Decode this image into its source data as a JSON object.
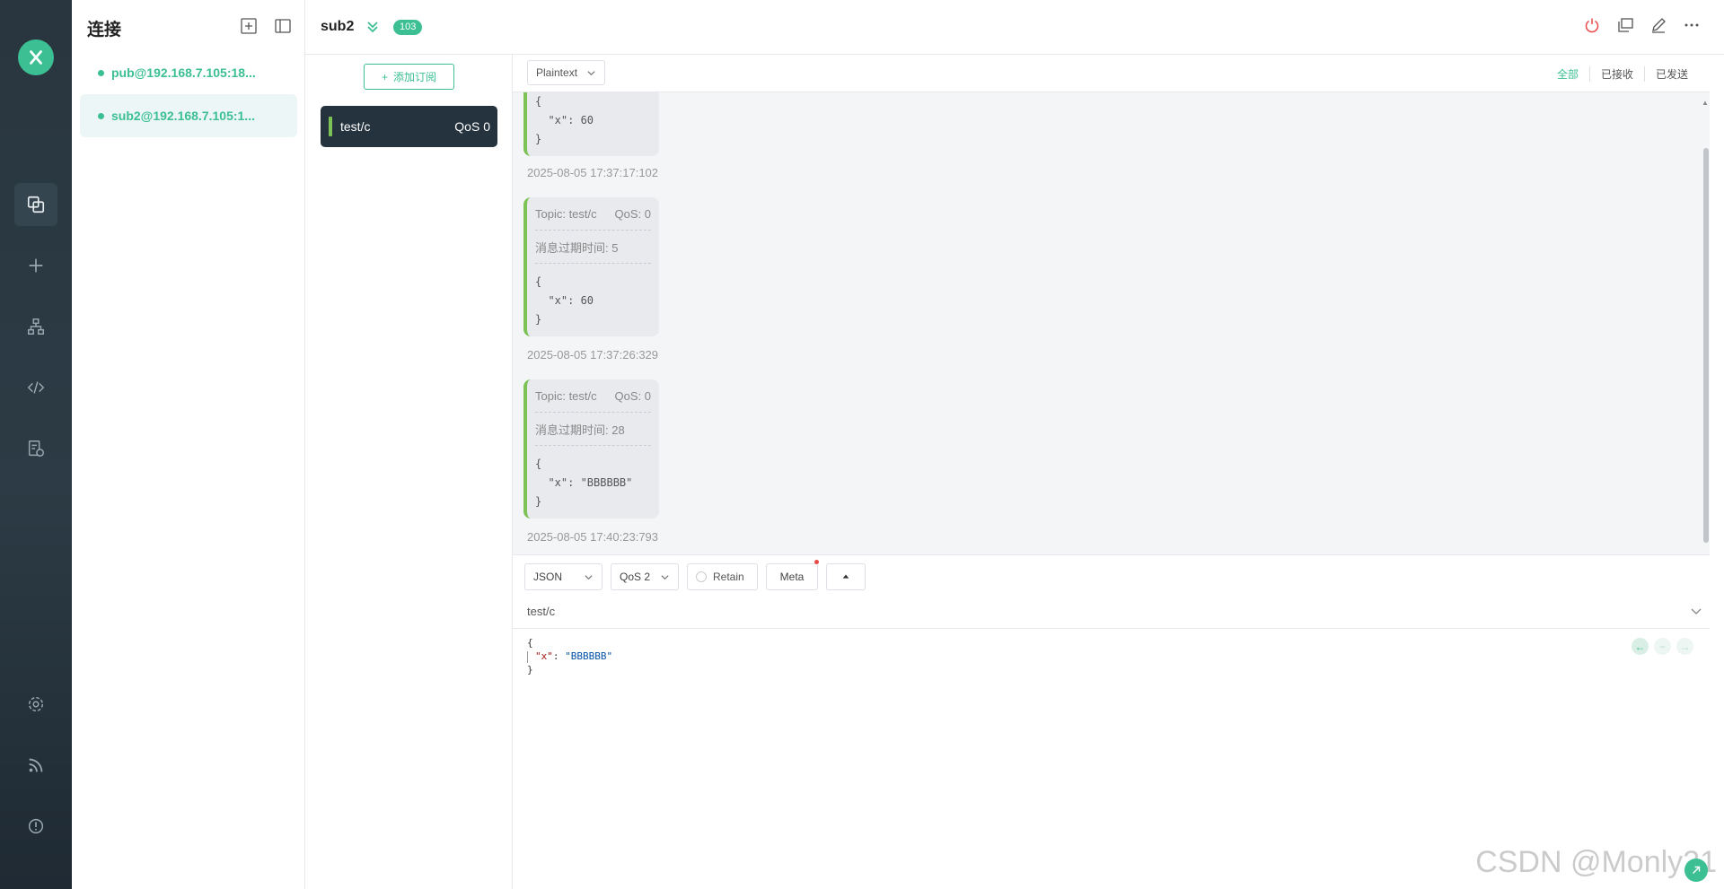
{
  "sidebar": {
    "logo": "mqttx-logo",
    "nav": [
      {
        "name": "connections",
        "icon": "connections-icon",
        "active": true
      },
      {
        "name": "new-connection",
        "icon": "plus-icon",
        "active": false
      },
      {
        "name": "topology",
        "icon": "topology-icon",
        "active": false
      },
      {
        "name": "script",
        "icon": "code-icon",
        "active": false
      },
      {
        "name": "log",
        "icon": "log-icon",
        "active": false
      },
      {
        "name": "settings",
        "icon": "gear-icon",
        "active": false
      },
      {
        "name": "subscribe-feed",
        "icon": "rss-icon",
        "active": false
      },
      {
        "name": "about",
        "icon": "info-icon",
        "active": false
      }
    ]
  },
  "connections": {
    "title": "连接",
    "items": [
      {
        "label": "pub@192.168.7.105:18...",
        "active": false,
        "status": "connected"
      },
      {
        "label": "sub2@192.168.7.105:1...",
        "active": true,
        "status": "connected"
      }
    ]
  },
  "header": {
    "name": "sub2",
    "count": "103"
  },
  "subscriptions": {
    "add_label": "添加订阅",
    "items": [
      {
        "topic": "test/c",
        "qos": "QoS 0",
        "color": "#7cc255"
      }
    ]
  },
  "messages": {
    "format": "Plaintext",
    "filters": [
      "全部",
      "已接收",
      "已发送"
    ],
    "list": [
      {
        "payload": "{\n  \"x\": 60\n}",
        "time": "2025-08-05 17:37:17:102"
      },
      {
        "topic": "Topic: test/c",
        "qos": "QoS: 0",
        "expiry": "消息过期时间: 5",
        "payload": "{\n  \"x\": 60\n}",
        "time": "2025-08-05 17:37:26:329"
      },
      {
        "topic": "Topic: test/c",
        "qos": "QoS: 0",
        "expiry": "消息过期时间: 28",
        "payload": "{\n  \"x\": \"BBBBBB\"\n}",
        "time": "2025-08-05 17:40:23:793"
      }
    ]
  },
  "publish": {
    "format": "JSON",
    "qos": "QoS 2",
    "retain_label": "Retain",
    "meta_label": "Meta",
    "topic": "test/c",
    "payload_open": "{",
    "payload_key": "\"x\"",
    "payload_colon": ": ",
    "payload_value": "\"BBBBBB\"",
    "payload_close": "}"
  },
  "watermark": "CSDN @Monly21",
  "colors": {
    "accent": "#3bbf93",
    "sidebar": "#293640",
    "topic_bar": "#7cc255"
  }
}
